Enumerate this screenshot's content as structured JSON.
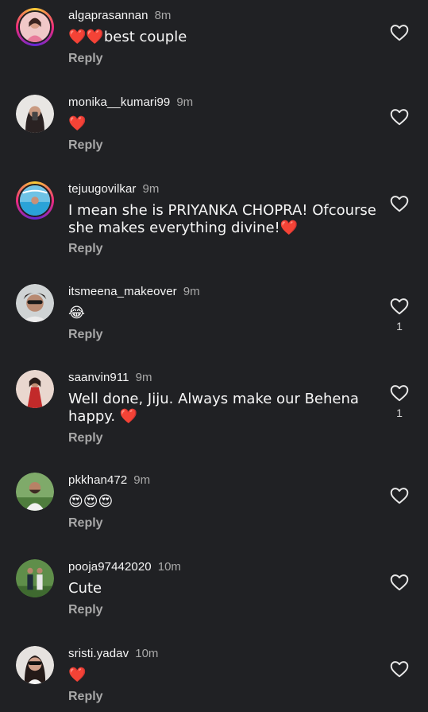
{
  "comments": [
    {
      "username": "algaprasannan",
      "time": "8m",
      "text": "❤️❤️best couple",
      "reply": "Reply",
      "likes": ""
    },
    {
      "username": "monika__kumari99",
      "time": "9m",
      "text": "❤️",
      "reply": "Reply",
      "likes": ""
    },
    {
      "username": "tejuugovilkar",
      "time": "9m",
      "text": "I mean she is PRIYANKA CHOPRA! Ofcourse she makes everything divine!❤️",
      "reply": "Reply",
      "likes": ""
    },
    {
      "username": "itsmeena_makeover",
      "time": "9m",
      "text": "😂",
      "reply": "Reply",
      "likes": "1"
    },
    {
      "username": "saanvin911",
      "time": "9m",
      "text": "Well done, Jiju. Always make our Behena happy. ❤️",
      "reply": "Reply",
      "likes": "1"
    },
    {
      "username": "pkkhan472",
      "time": "9m",
      "text": "😍😍😍",
      "reply": "Reply",
      "likes": ""
    },
    {
      "username": "pooja97442020",
      "time": "10m",
      "text": "Cute",
      "reply": "Reply",
      "likes": ""
    },
    {
      "username": "sristi.yadav",
      "time": "10m",
      "text": "❤️",
      "reply": "Reply",
      "likes": ""
    }
  ],
  "icons": {
    "like": "heart-outline-icon"
  },
  "colors": {
    "background": "#202124",
    "text_primary": "#f5f5f5",
    "text_secondary": "#a8a8a8",
    "heart_red": "#e02424"
  }
}
